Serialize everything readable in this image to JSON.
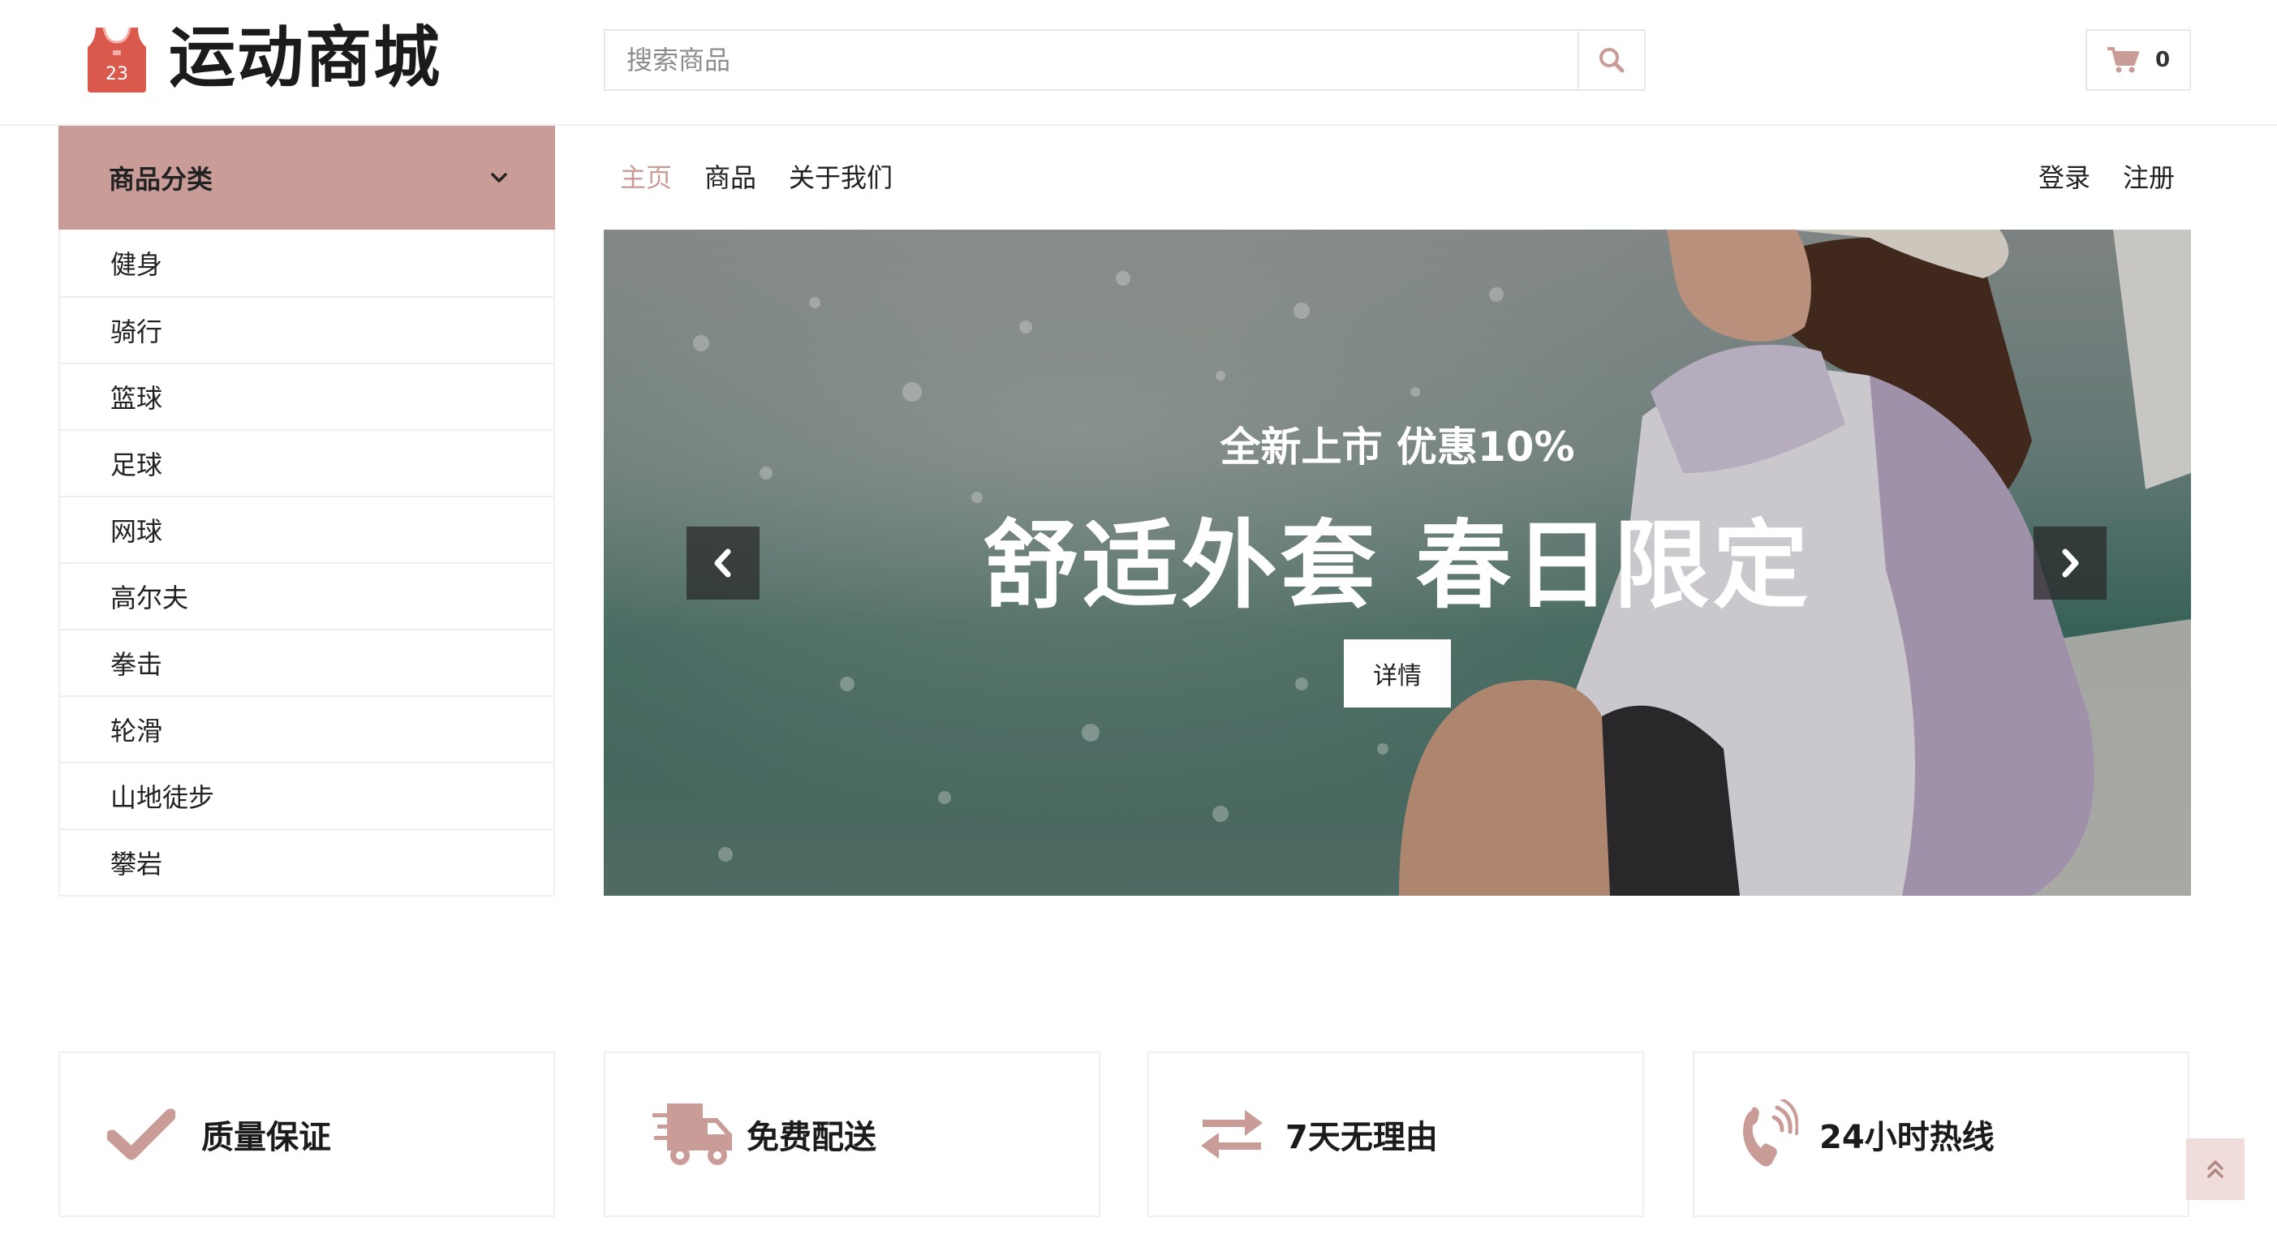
{
  "header": {
    "logo_text": "运动商城",
    "logo_number": "23",
    "search": {
      "placeholder": "搜索商品"
    },
    "cart": {
      "count": "0"
    }
  },
  "sidebar": {
    "title": "商品分类",
    "items": [
      "健身",
      "骑行",
      "篮球",
      "足球",
      "网球",
      "高尔夫",
      "拳击",
      "轮滑",
      "山地徒步",
      "攀岩"
    ]
  },
  "nav": {
    "links": [
      "主页",
      "商品",
      "关于我们"
    ],
    "active_index": 0,
    "login": "登录",
    "register": "注册"
  },
  "hero": {
    "subtitle": "全新上市 优惠10%",
    "title": "舒适外套 春日限定",
    "button": "详情"
  },
  "features": [
    {
      "label": "质量保证",
      "icon": "check-icon"
    },
    {
      "label": "免费配送",
      "icon": "truck-icon"
    },
    {
      "label": "7天无理由",
      "icon": "exchange-icon"
    },
    {
      "label": "24小时热线",
      "icon": "phone-icon"
    }
  ],
  "colors": {
    "accent": "#c99c98",
    "text": "#222222",
    "border": "#efefef"
  }
}
